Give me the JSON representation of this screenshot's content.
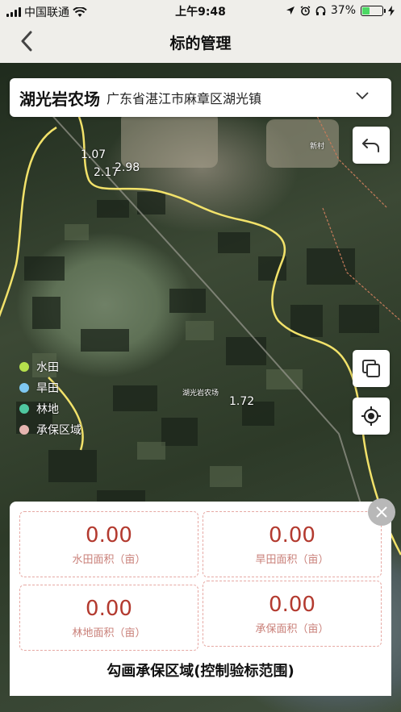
{
  "status_bar": {
    "carrier": "中国联通",
    "time": "上午9:48",
    "battery_percent": "37%",
    "battery_level": 0.37,
    "icons": [
      "signal-icon",
      "wifi-icon",
      "location-arrow-icon",
      "alarm-icon",
      "headphones-icon",
      "battery-icon",
      "charging-icon"
    ]
  },
  "nav": {
    "title": "标的管理",
    "back_icon": "chevron-left-icon"
  },
  "farm_selector": {
    "name": "湖光岩农场",
    "address": "广东省湛江市麻章区湖光镇",
    "icon": "chevron-down-icon"
  },
  "map": {
    "labels": [
      "1.07",
      "2.17",
      "2.98",
      "1.72"
    ],
    "place_names": [
      "湖光岩农场",
      "新村"
    ],
    "boundary_color": "#f2e26a"
  },
  "map_controls": {
    "undo_icon": "undo-arrow-icon",
    "layers_icon": "layers-icon",
    "locate_icon": "locate-target-icon"
  },
  "legend": [
    {
      "label": "水田",
      "color": "#b5e04c"
    },
    {
      "label": "旱田",
      "color": "#7ec8f2"
    },
    {
      "label": "林地",
      "color": "#4fc7a0"
    },
    {
      "label": "承保区域",
      "color": "#e5b5b0"
    }
  ],
  "panel": {
    "close_icon": "close-icon",
    "stats": [
      {
        "value": "0.00",
        "label": "水田面积（亩）"
      },
      {
        "value": "0.00",
        "label": "旱田面积（亩）"
      },
      {
        "value": "0.00",
        "label": "林地面积（亩）"
      },
      {
        "value": "0.00",
        "label": "承保面积（亩）"
      }
    ],
    "action": "勾画承保区域(控制验标范围)"
  },
  "colors": {
    "accent": "#b33a2f",
    "stat_label": "#c97f78",
    "dashed_border": "#e6a8a3"
  }
}
